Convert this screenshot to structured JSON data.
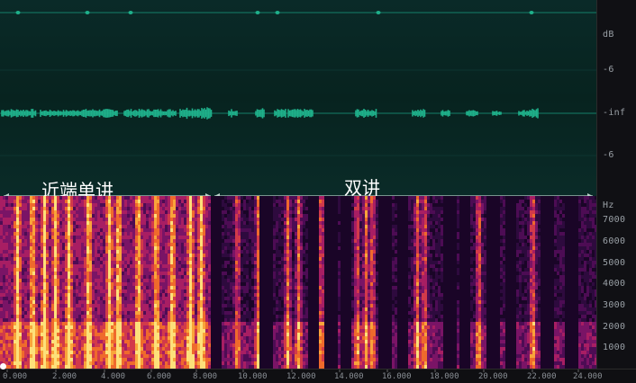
{
  "waveform": {
    "db_labels": [
      "dB",
      "-6",
      "-inf",
      "-6"
    ]
  },
  "spectrogram": {
    "freq_unit": "Hz",
    "freq_labels": [
      "7000",
      "6000",
      "5000",
      "4000",
      "3000",
      "2000",
      "1000"
    ]
  },
  "time_axis": {
    "labels": [
      "0.000",
      "2.000",
      "4.000",
      "6.000",
      "8.000",
      "10.000",
      "12.000",
      "14.000",
      "16.000",
      "18.000",
      "20.000",
      "22.000",
      "24.000"
    ]
  },
  "regions": [
    {
      "label": "近端单讲"
    },
    {
      "label": "双讲"
    }
  ],
  "colors": {
    "waveform": "#1fb08a",
    "region_marker": "#b9d2c9"
  }
}
